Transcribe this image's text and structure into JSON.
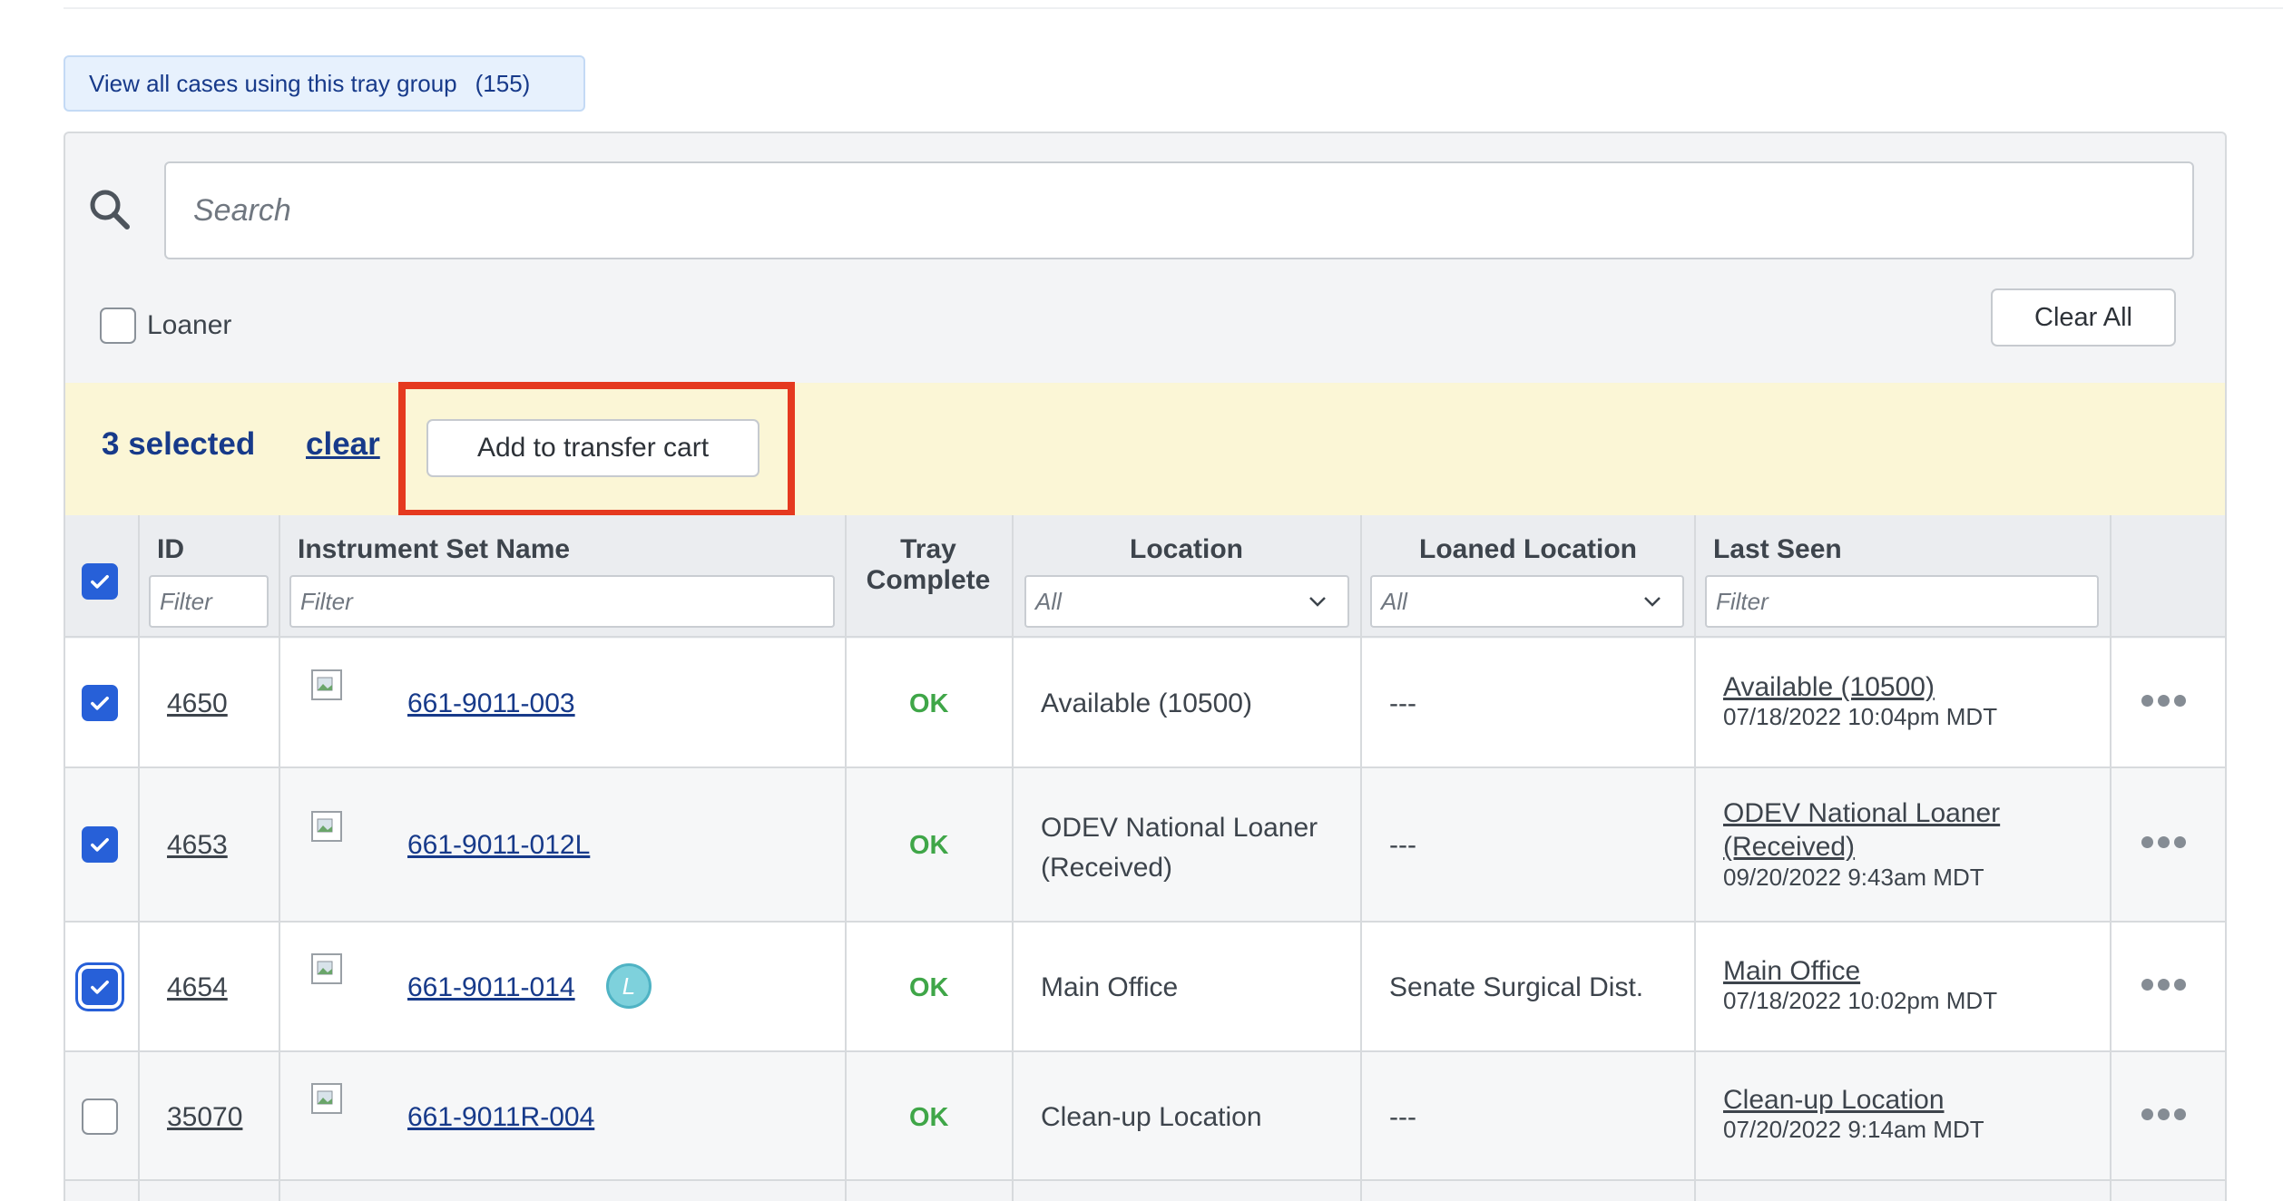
{
  "view_cases": {
    "label": "View all cases using this tray group",
    "count": "(155)"
  },
  "search": {
    "placeholder": "Search"
  },
  "loaner_filter": {
    "label": "Loaner",
    "checked": false
  },
  "clear_all_label": "Clear All",
  "selection": {
    "count_text": "3 selected",
    "clear_label": "clear",
    "add_to_cart_label": "Add to transfer cart"
  },
  "columns": {
    "id": "ID",
    "instrument_set_name": "Instrument Set Name",
    "tray_complete_line1": "Tray",
    "tray_complete_line2": "Complete",
    "location": "Location",
    "loaned_location": "Loaned Location",
    "last_seen": "Last Seen"
  },
  "filters": {
    "id_placeholder": "Filter",
    "name_placeholder": "Filter",
    "location_value": "All",
    "loaned_location_value": "All",
    "last_seen_placeholder": "Filter"
  },
  "rows": [
    {
      "id": "4650",
      "name": "661-9011-003",
      "loaner_badge": "",
      "tray_complete": "OK",
      "location_line1": "Available (10500)",
      "location_line2": "",
      "loaned_location": "---",
      "last_seen_location_line1": "Available (10500)",
      "last_seen_location_line2": "",
      "last_seen_time": "07/18/2022 10:04pm MDT",
      "checked": true
    },
    {
      "id": "4653",
      "name": "661-9011-012L",
      "loaner_badge": "",
      "tray_complete": "OK",
      "location_line1": "ODEV National Loaner",
      "location_line2": "(Received)",
      "loaned_location": "---",
      "last_seen_location_line1": "ODEV National Loaner",
      "last_seen_location_line2": "(Received)",
      "last_seen_time": "09/20/2022 9:43am MDT",
      "checked": true
    },
    {
      "id": "4654",
      "name": "661-9011-014",
      "loaner_badge": "L",
      "tray_complete": "OK",
      "location_line1": "Main Office",
      "location_line2": "",
      "loaned_location": "Senate Surgical Dist.",
      "last_seen_location_line1": "Main Office",
      "last_seen_location_line2": "",
      "last_seen_time": "07/18/2022 10:02pm MDT",
      "checked": true
    },
    {
      "id": "35070",
      "name": "661-9011R-004",
      "loaner_badge": "",
      "tray_complete": "OK",
      "location_line1": "Clean-up Location",
      "location_line2": "",
      "loaned_location": "---",
      "last_seen_location_line1": "Clean-up Location",
      "last_seen_location_line2": "",
      "last_seen_time": "07/20/2022 9:14am MDT",
      "checked": false
    }
  ],
  "colors": {
    "accent": "#2760d8",
    "link": "#173a8a",
    "ok": "#3fa648",
    "selection_bar": "#fbf6d6",
    "highlight": "#e5391f"
  },
  "icons": [
    "search-icon",
    "checkmark-icon",
    "chevron-down-icon",
    "image-placeholder-icon",
    "more-options-icon"
  ]
}
